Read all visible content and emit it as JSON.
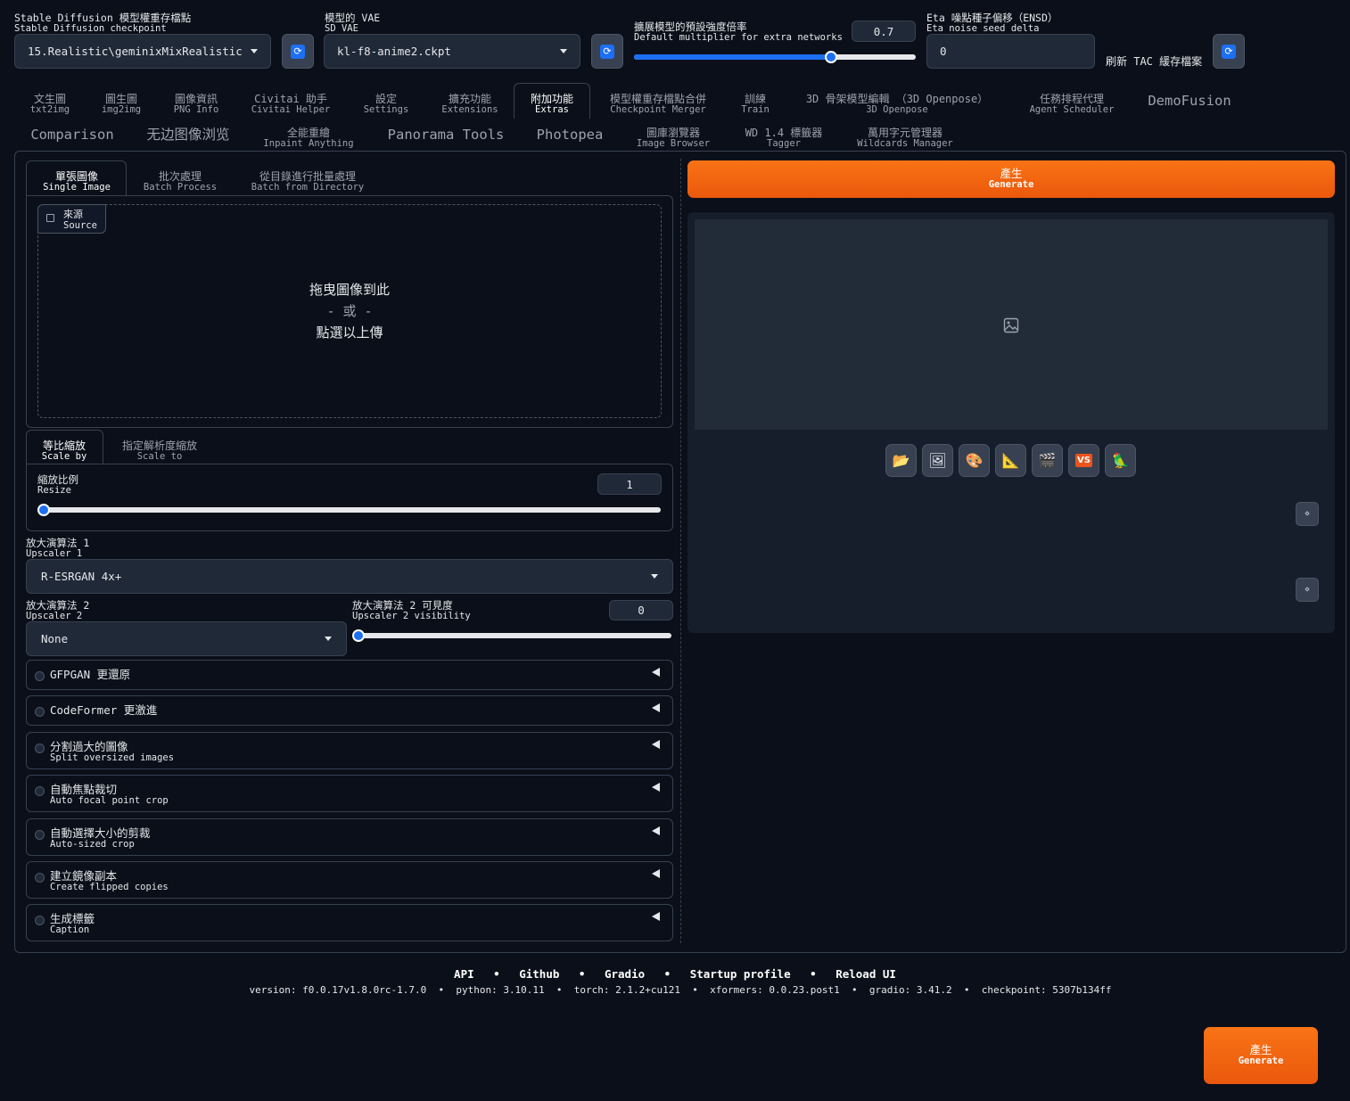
{
  "top": {
    "checkpoint": {
      "label_zh": "Stable Diffusion 模型權重存檔點",
      "label_en": "Stable Diffusion checkpoint",
      "value": "15.Realistic\\geminixMixRealistic"
    },
    "vae": {
      "label_zh": "模型的 VAE",
      "label_en": "SD VAE",
      "value": "kl-f8-anime2.ckpt"
    },
    "multiplier": {
      "label_zh": "擴展模型的預設強度倍率",
      "label_en": "Default multiplier for extra networks",
      "value": "0.7",
      "fraction": 0.7
    },
    "eta": {
      "label_zh": "Eta 噪點種子偏移（ENSD）",
      "label_en": "Eta noise seed delta",
      "value": "0"
    },
    "tac_refresh_label": "刷新 TAC 緩存檔案"
  },
  "tabs_row1": [
    {
      "zh": "文生圖",
      "en": "txt2img"
    },
    {
      "zh": "圖生圖",
      "en": "img2img"
    },
    {
      "zh": "圖像資訊",
      "en": "PNG Info"
    },
    {
      "zh": "Civitai 助手",
      "en": "Civitai Helper"
    },
    {
      "zh": "設定",
      "en": "Settings"
    },
    {
      "zh": "擴充功能",
      "en": "Extensions"
    },
    {
      "zh": "附加功能",
      "en": "Extras"
    },
    {
      "zh": "模型權重存檔點合併",
      "en": "Checkpoint Merger"
    },
    {
      "zh": "訓練",
      "en": "Train"
    },
    {
      "zh": "3D 骨架模型編輯 （3D Openpose）",
      "en": "3D Openpose"
    },
    {
      "zh": "任務排程代理",
      "en": "Agent Scheduler"
    },
    {
      "zh": "DemoFusion"
    }
  ],
  "tabs_row2": [
    {
      "zh": "Comparison"
    },
    {
      "zh": "无边图像浏览"
    },
    {
      "zh": "全能重繪",
      "en": "Inpaint Anything"
    },
    {
      "zh": "Panorama Tools"
    },
    {
      "zh": "Photopea"
    },
    {
      "zh": "圖庫瀏覽器",
      "en": "Image Browser"
    },
    {
      "zh": "WD 1.4 標籤器",
      "en": "Tagger"
    },
    {
      "zh": "萬用字元管理器",
      "en": "Wildcards Manager"
    }
  ],
  "subtabs": [
    {
      "zh": "單張圖像",
      "en": "Single Image"
    },
    {
      "zh": "批次處理",
      "en": "Batch Process"
    },
    {
      "zh": "從目錄進行批量處理",
      "en": "Batch from Directory"
    }
  ],
  "source": {
    "label_zh": "來源",
    "label_en": "Source",
    "drop_line1": "拖曳圖像到此",
    "drop_line2": "- 或 -",
    "drop_line3": "點選以上傳"
  },
  "scale_tabs": [
    {
      "zh": "等比縮放",
      "en": "Scale by"
    },
    {
      "zh": "指定解析度縮放",
      "en": "Scale to"
    }
  ],
  "resize": {
    "label_zh": "縮放比例",
    "label_en": "Resize",
    "value": "1",
    "fraction": 0.0
  },
  "upscaler1": {
    "label_zh": "放大演算法 1",
    "label_en": "Upscaler 1",
    "value": "R-ESRGAN 4x+"
  },
  "upscaler2": {
    "label_zh": "放大演算法 2",
    "label_en": "Upscaler 2",
    "value": "None"
  },
  "upscaler2_vis": {
    "label_zh": "放大演算法 2 可見度",
    "label_en": "Upscaler 2 visibility",
    "value": "0",
    "fraction": 0.0
  },
  "accordions": [
    {
      "zh": "GFPGAN 更還原"
    },
    {
      "zh": "CodeFormer 更激進"
    },
    {
      "zh": "分割過大的圖像",
      "en": "Split oversized images"
    },
    {
      "zh": "自動焦點裁切",
      "en": "Auto focal point crop"
    },
    {
      "zh": "自動選擇大小的剪裁",
      "en": "Auto-sized crop"
    },
    {
      "zh": "建立鏡像副本",
      "en": "Create flipped copies"
    },
    {
      "zh": "生成標籤",
      "en": "Caption"
    }
  ],
  "generate": {
    "zh": "產生",
    "en": "Generate"
  },
  "toolbar_icons": [
    "folder-icon",
    "image-icon",
    "palette-icon",
    "ruler-icon",
    "clapper-icon",
    "vs-icon",
    "parrot-icon"
  ],
  "footer": {
    "links": [
      "API",
      "Github",
      "Gradio",
      "Startup profile",
      "Reload UI"
    ],
    "version": "version: f0.0.17v1.8.0rc-1.7.0  •  python: 3.10.11  •  torch: 2.1.2+cu121  •  xformers: 0.0.23.post1  •  gradio: 3.41.2  •  checkpoint: 5307b134ff"
  },
  "colors": {
    "accent": "#1d6ff2",
    "orange": "#f97316",
    "background": "#0b0f19"
  }
}
